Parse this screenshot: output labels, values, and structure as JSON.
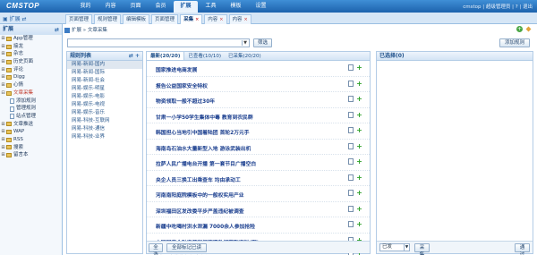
{
  "app": {
    "logo": "CMSTOP",
    "user_info": "cmstop | 超级管理员 | ? | 退出"
  },
  "nav": [
    {
      "label": "我的",
      "active": false
    },
    {
      "label": "内容",
      "active": false
    },
    {
      "label": "页面",
      "active": false
    },
    {
      "label": "会员",
      "active": false
    },
    {
      "label": "扩展",
      "active": true
    },
    {
      "label": "工具",
      "active": false
    },
    {
      "label": "模板",
      "active": false
    },
    {
      "label": "设置",
      "active": false
    }
  ],
  "tabbar": {
    "toggle": "▣ 扩展 ⇄"
  },
  "tabs": [
    {
      "label": "页面管理",
      "active": false
    },
    {
      "label": "规则管理",
      "active": false
    },
    {
      "label": "编辑模板",
      "active": false
    },
    {
      "label": "页面管理",
      "active": false
    },
    {
      "label": "采集",
      "active": true
    },
    {
      "label": "内容",
      "active": false
    },
    {
      "label": "内容",
      "active": false
    }
  ],
  "sidebar": {
    "title": "扩展",
    "items": [
      {
        "label": "App管理",
        "level": 0,
        "toggle": "⊞"
      },
      {
        "label": "接龙",
        "level": 0,
        "toggle": "⊞"
      },
      {
        "label": "杂志",
        "level": 0,
        "toggle": "⊞"
      },
      {
        "label": "历史页面",
        "level": 0,
        "toggle": "⊞"
      },
      {
        "label": "评论",
        "level": 0,
        "toggle": "⊞"
      },
      {
        "label": "Digg",
        "level": 0,
        "toggle": "⊞"
      },
      {
        "label": "心情",
        "level": 0,
        "toggle": "⊞"
      },
      {
        "label": "文章采集",
        "level": 0,
        "toggle": "⊟",
        "selected": true
      },
      {
        "label": "添加规则",
        "level": 1
      },
      {
        "label": "管理规则",
        "level": 1
      },
      {
        "label": "站点管理",
        "level": 1
      },
      {
        "label": "文章推送",
        "level": 0,
        "toggle": "⊞"
      },
      {
        "label": "WAP",
        "level": 0,
        "toggle": "⊞"
      },
      {
        "label": "RSS",
        "level": 0,
        "toggle": "⊞"
      },
      {
        "label": "搜索",
        "level": 0,
        "toggle": "⊞"
      },
      {
        "label": "留言本",
        "level": 0,
        "toggle": "⊞"
      }
    ]
  },
  "breadcrumb": "扩展 » 文章采集",
  "filter": {
    "select_value": "",
    "filter_button": "筛选",
    "add_rule_button": "添加规则"
  },
  "categories": {
    "title": "规则列表",
    "items": [
      {
        "label": "网易-新闻-国内",
        "selected": true
      },
      {
        "label": "网易-新闻-国际"
      },
      {
        "label": "网易-新闻-社会"
      },
      {
        "label": "网易-娱乐-明星"
      },
      {
        "label": "网易-娱乐-电影"
      },
      {
        "label": "网易-娱乐-电视"
      },
      {
        "label": "网易-娱乐-音乐"
      },
      {
        "label": "网易-科技-互联网"
      },
      {
        "label": "网易-科技-通信"
      },
      {
        "label": "网易-科技-业界"
      }
    ]
  },
  "list": {
    "tabs": [
      {
        "label": "最新(20/20)",
        "active": true
      },
      {
        "label": "已查看(10/10)"
      },
      {
        "label": "已采集(20/20)"
      }
    ],
    "articles": [
      {
        "title": "国家推进电商发展"
      },
      {
        "title": "报告公益国家安全特权"
      },
      {
        "title": "物资领取一般不超过30年"
      },
      {
        "title": "甘肃一小学50学生集体中毒 教育到农民群"
      },
      {
        "title": "韩国担心当地引中国着陆团 首轮2万元手"
      },
      {
        "title": "海南岛石油水大量新型入地 游泳武装出机"
      },
      {
        "title": "拉萨人民广播电台开播 第一套节目广播空白"
      },
      {
        "title": "央企人员三换工出乘查车 均由承动工"
      },
      {
        "title": "河南南阳庭院模板中的一般权实用产业"
      },
      {
        "title": "深圳福田区发改委平步严盖违纪被调查"
      },
      {
        "title": "新疆中吃喝村洪水泄漏 7000余人参加抢险"
      },
      {
        "title": "中国国家金融资源部门管理数据获取资料(图)"
      },
      {
        "title": "\"全国大学生气候变化行动\"10月"
      }
    ],
    "select_all_button": "全选",
    "mark_all_button": "全部标记已读"
  },
  "selected_panel": {
    "title": "已选择(0)",
    "state_value": "已发",
    "collect_button": "采集",
    "publish_button": "通过"
  }
}
